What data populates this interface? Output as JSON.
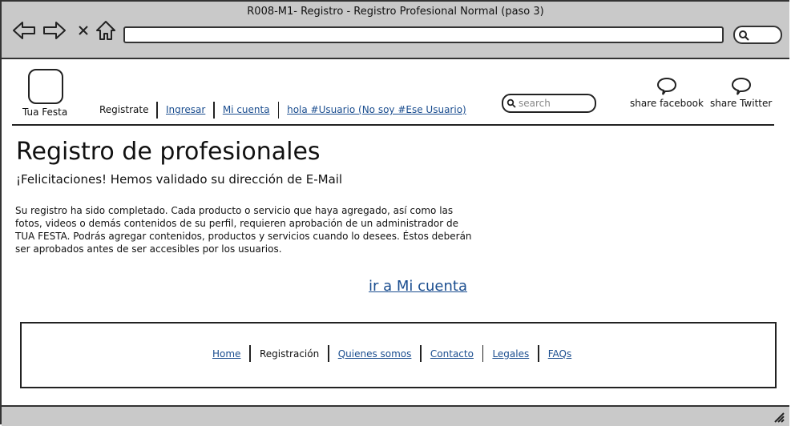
{
  "window": {
    "title": "R008-M1- Registro - Registro Profesional Normal (paso 3)"
  },
  "header": {
    "logo_label": "Tua Festa",
    "nav": [
      "Registrate",
      "Ingresar",
      "Mi cuenta",
      "hola #Usuario (No soy #Ese Usuario)"
    ],
    "search_placeholder": "search",
    "share_facebook": "share facebook",
    "share_twitter": "share Twitter"
  },
  "main": {
    "title": "Registro de profesionales",
    "subtitle": "¡Felicitaciones! Hemos validado su dirección de E-Mail",
    "paragraph": "Su registro ha sido completado. Cada producto o servicio que haya agregado, así como las fotos, videos o demás contenidos de su perfil, requieren aprobación de un administrador de TUA FESTA. Podrás agregar contenidos, productos y servicios cuando lo desees. Éstos deberán ser aprobados antes de ser accesibles por los usuarios.",
    "cta": "ir a Mi cuenta"
  },
  "footer": {
    "nav": [
      "Home",
      "Registración",
      "Quienes somos",
      "Contacto",
      "Legales",
      "FAQs"
    ]
  },
  "colors": {
    "chrome": "#c9c9c9",
    "link": "#1a4d8f"
  }
}
